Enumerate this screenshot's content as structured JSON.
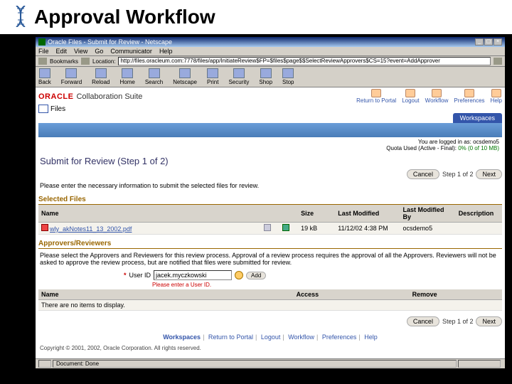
{
  "slide": {
    "title": "Approval Workflow"
  },
  "window": {
    "title": "Oracle Files - Submit for Review - Netscape",
    "menu": [
      "File",
      "Edit",
      "View",
      "Go",
      "Communicator",
      "Help"
    ],
    "bookmarks": "Bookmarks",
    "location_label": "Location:",
    "location": "http://files.oracleum.com:7778/files/app/InitiateReview$FP=$files$page$$SelectReviewApprovers$CS=15?event=AddApprover",
    "toolbar": [
      "Back",
      "Forward",
      "Reload",
      "Home",
      "Search",
      "Netscape",
      "Print",
      "Security",
      "Shop",
      "Stop"
    ],
    "status": "Document: Done"
  },
  "brand": {
    "oracle": "ORACLE",
    "suite": "Collaboration Suite",
    "files": "Files",
    "links": [
      "Return to Portal",
      "Logout",
      "Workflow",
      "Preferences",
      "Help"
    ],
    "workspaces_tab": "Workspaces"
  },
  "login": {
    "line1": "You are logged in as: ocsdemo5",
    "line2_a": "Quota Used (Active - Final): ",
    "line2_b": "0% (0 of 10 MB)"
  },
  "page": {
    "title": "Submit for Review (Step 1 of 2)",
    "cancel": "Cancel",
    "step": "Step 1 of 2",
    "next": "Next",
    "instruction": "Please enter the necessary information to submit the selected files for review."
  },
  "selected": {
    "heading": "Selected Files",
    "cols": {
      "name": "Name",
      "size": "Size",
      "lm": "Last Modified",
      "lmb": "Last Modified By",
      "desc": "Description"
    },
    "row": {
      "name": "wly_akNotes11_13_2002.pdf",
      "size": "19 kB",
      "lm": "11/12/02 4:38 PM",
      "lmb": "ocsdemo5",
      "desc": ""
    }
  },
  "approvers": {
    "heading": "Approvers/Reviewers",
    "instr": "Please select the Approvers and Reviewers for this review process. Approval of a review process requires the approval of all the Approvers. Reviewers will not be asked to approve the review process, but are notified that files were submitted for review.",
    "userid_label": "User ID",
    "userid_value": "jacek.myczkowski",
    "add": "Add",
    "error": "Please enter a User ID.",
    "cols": {
      "name": "Name",
      "access": "Access",
      "remove": "Remove"
    },
    "empty": "There are no items to display."
  },
  "footer": {
    "links": [
      "Workspaces",
      "Return to Portal",
      "Logout",
      "Workflow",
      "Preferences",
      "Help"
    ],
    "copyright": "Copyright © 2001, 2002, Oracle Corporation. All rights reserved."
  }
}
